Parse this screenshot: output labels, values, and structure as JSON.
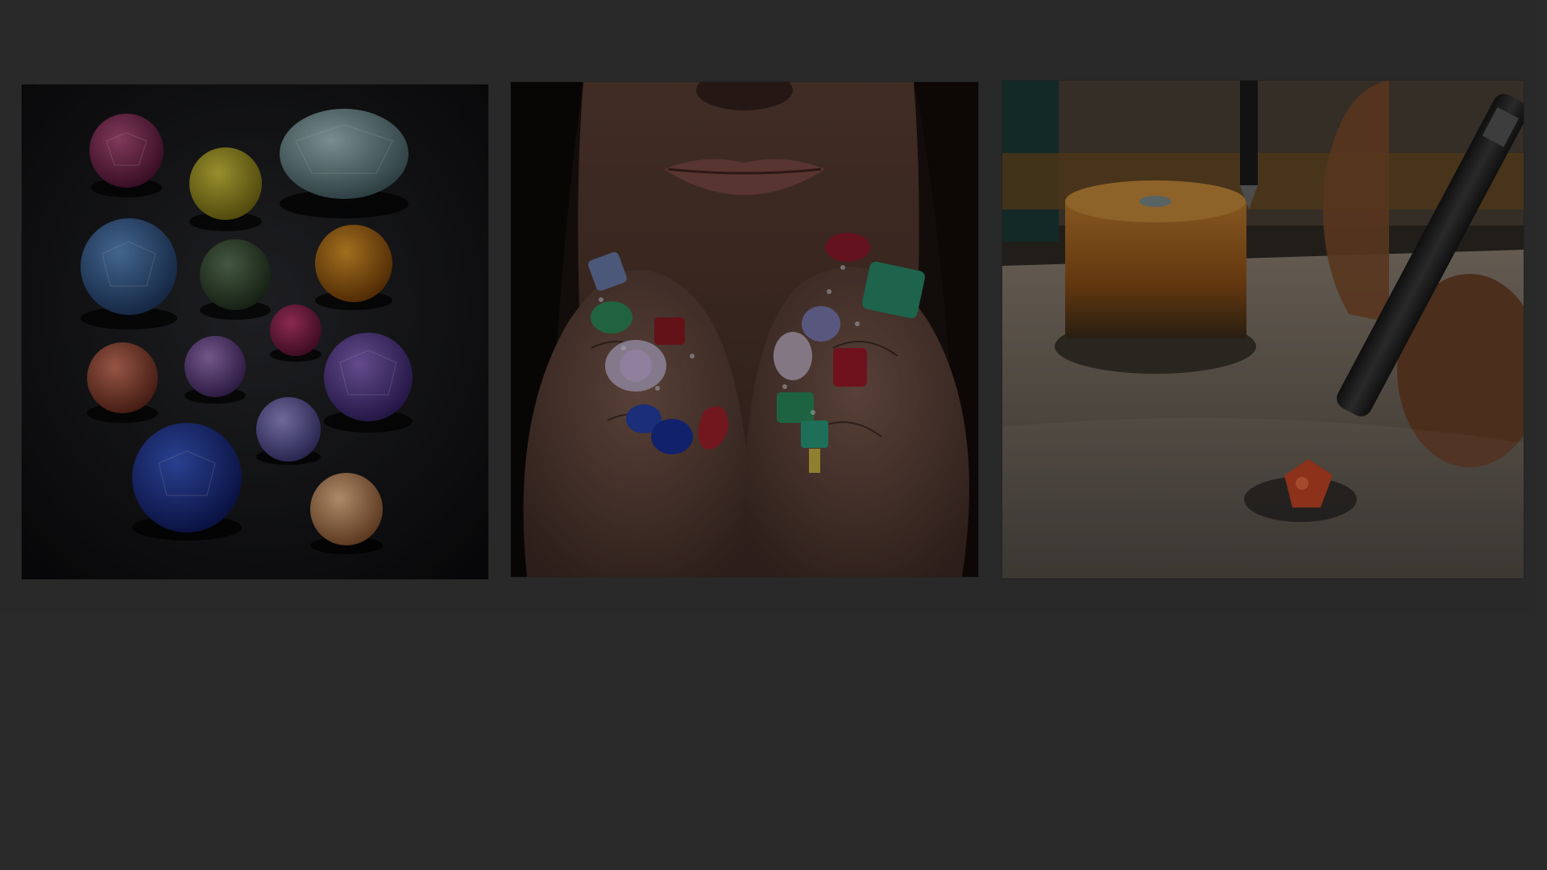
{
  "gallery": {
    "images": [
      {
        "icon": "gemstones-image",
        "alt": ""
      },
      {
        "icon": "hands-with-gem-rings-image",
        "alt": ""
      },
      {
        "icon": "gem-setting-workshop-image",
        "alt": ""
      }
    ]
  },
  "colors": {
    "page_background": "#3a3a3a",
    "tile1_background": "#111214",
    "tile2_background": "#1d1613",
    "tile3_background": "#2a241e"
  }
}
